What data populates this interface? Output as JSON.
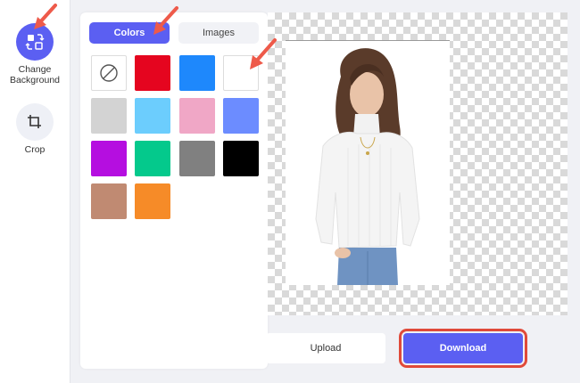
{
  "sidebar": {
    "tools": [
      {
        "label": "Change\nBackground",
        "icon": "change-background-icon",
        "active": true
      },
      {
        "label": "Crop",
        "icon": "crop-icon",
        "active": false
      }
    ]
  },
  "panel": {
    "tabs": {
      "colors": "Colors",
      "images": "Images"
    },
    "swatches": [
      {
        "name": "none",
        "color": "#ffffff"
      },
      {
        "name": "red",
        "color": "#e5051f"
      },
      {
        "name": "blue",
        "color": "#1e88fc"
      },
      {
        "name": "white",
        "color": "#ffffff"
      },
      {
        "name": "light-gray",
        "color": "#d3d3d3"
      },
      {
        "name": "sky-blue",
        "color": "#6ccdfd"
      },
      {
        "name": "pink",
        "color": "#f0a7c6"
      },
      {
        "name": "periwinkle",
        "color": "#6c8cff"
      },
      {
        "name": "purple",
        "color": "#b50ee0"
      },
      {
        "name": "green",
        "color": "#04c98c"
      },
      {
        "name": "gray",
        "color": "#808080"
      },
      {
        "name": "black",
        "color": "#000000"
      },
      {
        "name": "tan",
        "color": "#c08a72"
      },
      {
        "name": "orange",
        "color": "#f68b28"
      }
    ]
  },
  "actions": {
    "upload": "Upload",
    "download": "Download"
  },
  "colors": {
    "accent": "#5b5ff2",
    "highlight": "#e04a3a"
  }
}
